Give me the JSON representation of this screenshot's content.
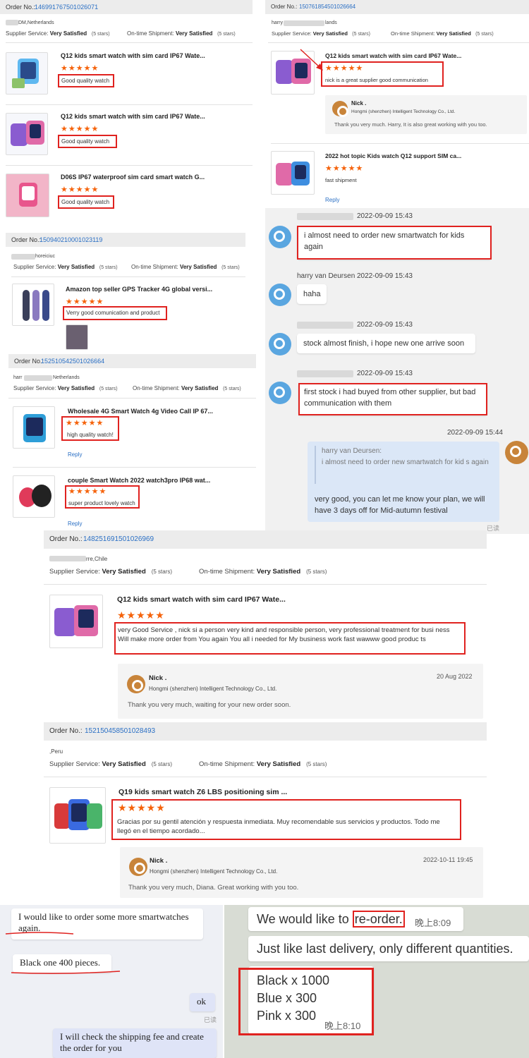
{
  "colors": {
    "accent": "#2a6fc4",
    "star": "#f5620a",
    "highlight": "#e0221f",
    "chat_bg": "#f1f1f1"
  },
  "stars": "★★★★★",
  "panel1": {
    "order_label": "Order No.:",
    "order_no": "146991767501026071",
    "buyer": "DM,Netherlands",
    "supplier_label": "Supplier Service:",
    "supplier_value": "Very Satisfied",
    "stars_note": "(5 stars)",
    "shipment_label": "On-time Shipment:",
    "shipment_value": "Very Satisfied",
    "stars_note2": "(5 stars)",
    "items": [
      {
        "title": "Q12 kids smart watch with sim card IP67 Wate...",
        "review": "Good quality watch"
      },
      {
        "title": "Q12 kids smart watch with sim card IP67 Wate...",
        "review": "Good quality watch"
      },
      {
        "title": "D06S IP67 waterproof sim card smart watch G...",
        "review": "Good quality watch"
      }
    ]
  },
  "panel2": {
    "order_label": "Order No.:",
    "order_no": "150940210001023119",
    "buyer": "horeiciuc",
    "supplier_label": "Supplier Service:",
    "supplier_value": "Very Satisfied",
    "stars_note": "(5 stars)",
    "shipment_label": "On-time Shipment:",
    "shipment_value": "Very Satisfied",
    "stars_note2": "(5 stars)",
    "item": {
      "title": "Amazon top seller GPS Tracker 4G global versi...",
      "review": "Verry good comunication and product"
    }
  },
  "panel3": {
    "order_label": "Order No.:",
    "order_no": "152510542501026664",
    "buyer_a": "harr",
    "buyer_b": "Netherlands",
    "supplier_label": "Supplier Service:",
    "supplier_value": "Very Satisfied",
    "stars_note": "(5 stars)",
    "shipment_label": "On-time Shipment:",
    "shipment_value": "Very Satisfied",
    "stars_note2": "(5 stars)",
    "items": [
      {
        "title": "Wholesale 4G Smart Watch 4g Video Call IP 67...",
        "review": "high quality watch!",
        "reply": "Reply"
      },
      {
        "title": "couple Smart Watch 2022 watch3pro IP68 wat...",
        "review": "super product lovely watch",
        "reply": "Reply"
      }
    ]
  },
  "panel4": {
    "order_label": "Order No.:",
    "order_no": "150761854501026664",
    "buyer_a": "harry",
    "buyer_b": "lands",
    "supplier_label": "Supplier Service:",
    "supplier_value": "Very Satisfied",
    "stars_note": "(5 stars)",
    "shipment_label": "On-time Shipment:",
    "shipment_value": "Very Satisfied",
    "stars_note2": "(5 stars)",
    "item1": {
      "title": "Q12 kids smart watch with sim card IP67 Wate...",
      "review": "nick is a great supplier good communication"
    },
    "seller_reply": {
      "name": "Nick .",
      "company": "Hongmi (shenzhen) Intelligent Technology Co., Ltd.",
      "text": "Thank you very much. Harry, It is also great working with you too."
    },
    "item2": {
      "title": "2022 hot topic Kids watch Q12 support SIM ca...",
      "review": "fast shipment",
      "reply": "Reply"
    }
  },
  "chat": {
    "messages": [
      {
        "time": "2022-09-09 15:43",
        "text": "i almost need to order new smartwatch for kids again"
      },
      {
        "name": "harry van Deursen",
        "time": "2022-09-09 15:43",
        "text": "haha"
      },
      {
        "time": "2022-09-09 15:43",
        "text": "stock almost finish, i hope new one arrive soon"
      },
      {
        "time": "2022-09-09 15:43",
        "text": "first stock i had buyed from other supplier, but bad communication with them"
      }
    ],
    "own": {
      "time": "2022-09-09 15:44",
      "quote_name": "harry van Deursen:",
      "quote_text": "i almost need to order new smartwatch for kid s again",
      "text": "very good, you can let me know your plan, we will have 3 days off for Mid-autumn festival",
      "read": "已读"
    }
  },
  "panel5": {
    "order_label": "Order No.:",
    "order_no": "148251691501026969",
    "buyer": "rre,Chile",
    "supplier_label": "Supplier Service:",
    "supplier_value": "Very Satisfied",
    "stars_note": "(5 stars)",
    "shipment_label": "On-time Shipment:",
    "shipment_value": "Very Satisfied",
    "stars_note2": "(5 stars)",
    "item": {
      "title": "Q12 kids smart watch with sim card IP67 Wate...",
      "review": "very Good Service , nick si a person  very kind and responsible person, very professional treatment for busi ness Will make more order from You again You all i needed for My business work fast wawww good produc ts"
    },
    "seller_reply": {
      "name": "Nick .",
      "company": "Hongmi (shenzhen) Intelligent Technology Co., Ltd.",
      "date": "20 Aug 2022",
      "text": "Thank you very much, waiting for your new order soon."
    }
  },
  "panel6": {
    "order_label": "Order No.:",
    "order_no": "152150458501028493",
    "buyer": ",Peru",
    "supplier_label": "Supplier Service:",
    "supplier_value": "Very Satisfied",
    "stars_note": "(5 stars)",
    "shipment_label": "On-time Shipment:",
    "shipment_value": "Very Satisfied",
    "stars_note2": "(5 stars)",
    "item": {
      "title": "Q19 kids smart watch Z6 LBS positioning sim ...",
      "review": "Gracias por su gentil atención y respuesta inmediata. Muy recomendable sus servicios y productos. Todo me llegó en el tiempo acordado..."
    },
    "seller_reply": {
      "name": "Nick .",
      "company": "Hongmi (shenzhen) Intelligent Technology Co., Ltd.",
      "date": "2022-10-11 19:45",
      "text": "Thank you very much, Diana. Great working with you too."
    }
  },
  "chat2": {
    "m1": "I would like to order some more smartwatches again.",
    "m2": "Black one 400 pieces.",
    "m3": "ok",
    "read": "已读",
    "m4": "I will check the shipping fee and create the order for you"
  },
  "wa": {
    "m1a": "We would like to ",
    "m1b": "re-order.",
    "m1time": "晚上8:09",
    "m2": "Just like last delivery, only different quantities.",
    "m3": [
      "Black x 1000",
      "Blue x 300",
      "Pink x 300"
    ],
    "m3time": "晚上8:10"
  }
}
